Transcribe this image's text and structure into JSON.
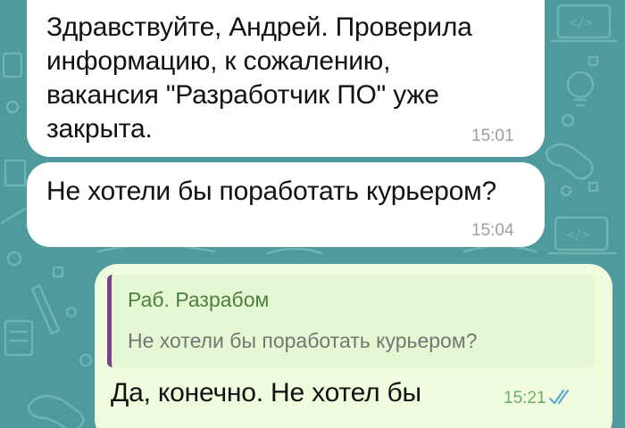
{
  "colors": {
    "background": "#4e9a9c",
    "incoming_bubble": "#ffffff",
    "outgoing_bubble": "#effdde",
    "reply_bar": "#7a3f8e",
    "reply_author": "#4e7f3e",
    "outgoing_time": "#72a96b"
  },
  "messages": [
    {
      "direction": "incoming",
      "lines": [
        "Здравствуйте, Андрей. Проверила",
        "информацию, к сожалению,",
        "вакансия \"Разработчик ПО\" уже",
        "закрыта."
      ],
      "time": "15:01"
    },
    {
      "direction": "incoming",
      "lines": [
        "Не хотели бы поработать курьером?"
      ],
      "time": "15:04"
    },
    {
      "direction": "outgoing",
      "reply": {
        "author": "Раб. Разрабом",
        "text": "Не хотели бы поработать курьером?"
      },
      "lines": [
        "Да, конечно. Не хотел бы"
      ],
      "time": "15:21",
      "status_icon": "double-check-icon"
    }
  ]
}
